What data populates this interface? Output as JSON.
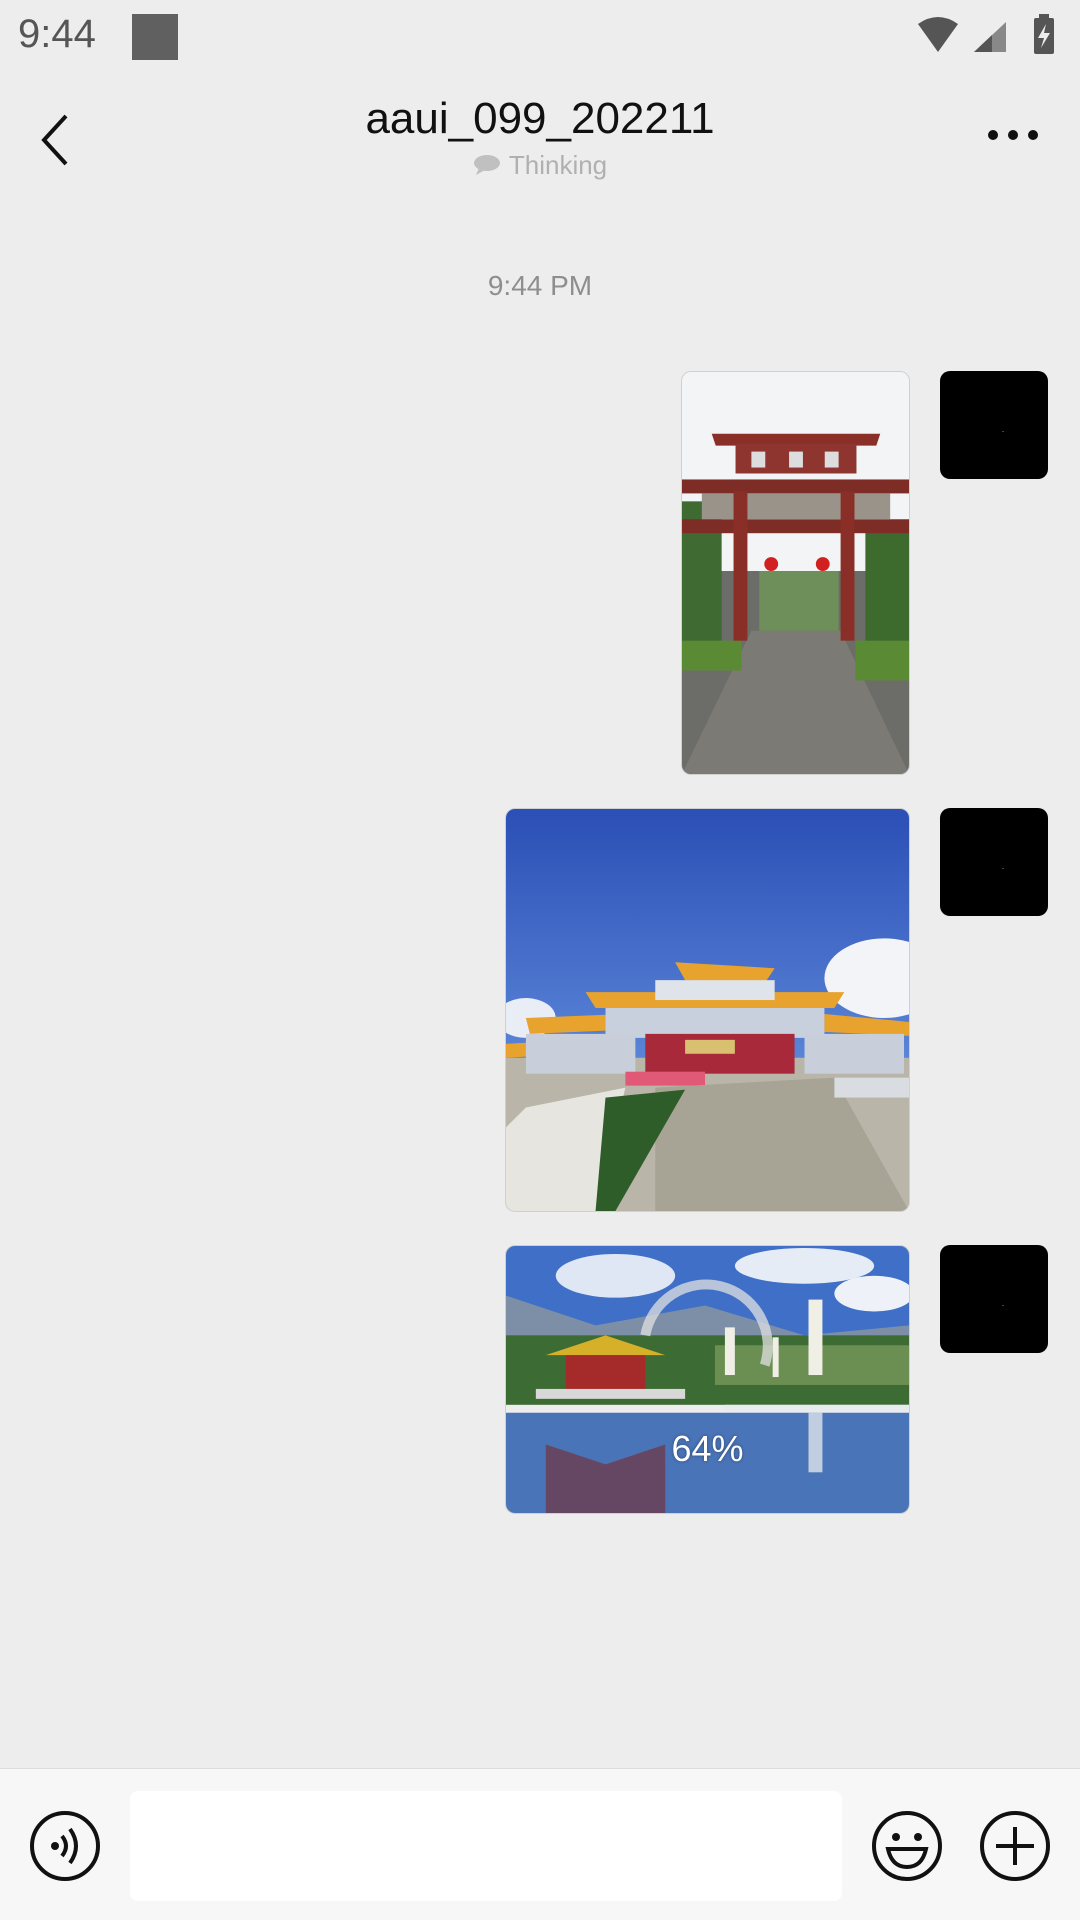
{
  "status_bar": {
    "time": "9:44",
    "icons": [
      "wifi-icon",
      "cell-signal-icon",
      "battery-charging-icon"
    ]
  },
  "header": {
    "title": "aaui_099_202211",
    "subtitle": "Thinking",
    "back_icon": "chevron-left-icon",
    "more_icon": "more-horizontal-icon"
  },
  "chat": {
    "timestamp": "9:44 PM",
    "messages": [
      {
        "type": "image",
        "sender": "me",
        "description": "temple gate"
      },
      {
        "type": "image",
        "sender": "me",
        "description": "temple"
      },
      {
        "type": "image",
        "sender": "me",
        "description": "pagodas by lake",
        "upload_progress": "64%"
      }
    ]
  },
  "input_bar": {
    "voice_icon": "voice-icon",
    "emoji_icon": "emoji-icon",
    "plus_icon": "plus-circle-icon",
    "input_value": ""
  },
  "colors": {
    "background": "#ededed",
    "input_bar": "#f7f7f7",
    "avatar": "#000000"
  }
}
